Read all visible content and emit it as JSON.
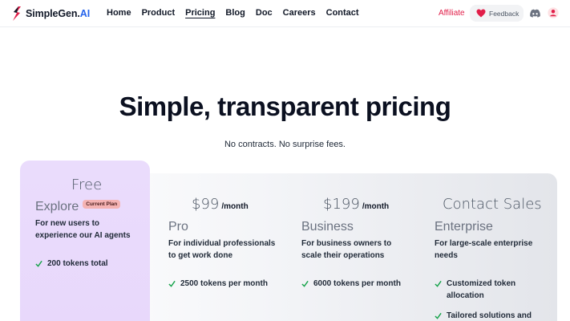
{
  "brand": {
    "name": "SimpleGen",
    "dot": ".",
    "suffix": "AI",
    "accent": "#2563eb"
  },
  "nav": {
    "links": [
      "Home",
      "Product",
      "Pricing",
      "Blog",
      "Doc",
      "Careers",
      "Contact"
    ],
    "active": "Pricing",
    "affiliate": "Affiliate",
    "feedback": "Feedback",
    "icons": [
      "heart-icon",
      "discord-icon",
      "user-icon"
    ]
  },
  "hero": {
    "title": "Simple, transparent pricing",
    "subtitle": "No contracts. No surprise fees."
  },
  "plans": [
    {
      "price": "Free",
      "per": "",
      "tier": "Explore",
      "badge": "Current Plan",
      "description": "For new users to experience our AI agents",
      "features": [
        "200 tokens total"
      ]
    },
    {
      "price": "$99",
      "per": "/month",
      "tier": "Pro",
      "description": "For individual professionals to get work done",
      "features": [
        "2500 tokens per month"
      ]
    },
    {
      "price": "$199",
      "per": "/month",
      "tier": "Business",
      "description": "For business owners to scale their operations",
      "features": [
        "6000 tokens per month"
      ]
    },
    {
      "price": "Contact Sales",
      "per": "",
      "tier": "Enterprise",
      "description": "For large-scale enterprise needs",
      "features": [
        "Customized token allocation",
        "Tailored solutions and"
      ]
    }
  ],
  "colors": {
    "check": "#16a34a",
    "free_card": "#e9dafb",
    "badge": "#f5b3b3",
    "affiliate": "#e11d48"
  }
}
